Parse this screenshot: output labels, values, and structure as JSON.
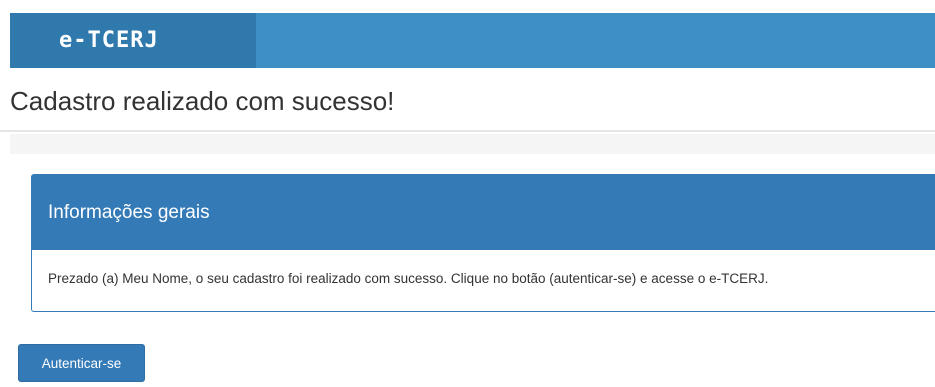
{
  "app": {
    "brand": "e-TCERJ"
  },
  "header": {
    "title": "Cadastro realizado com sucesso!"
  },
  "panel": {
    "title": "Informações gerais",
    "message": "Prezado (a) Meu Nome, o seu cadastro foi realizado com sucesso. Clique no botão (autenticar-se) e acesse o e-TCERJ."
  },
  "actions": {
    "authenticate_label": "Autenticar-se"
  },
  "colors": {
    "topbar": "#3d8fc4",
    "brand_block": "#2f79ad",
    "primary": "#337ab7"
  }
}
